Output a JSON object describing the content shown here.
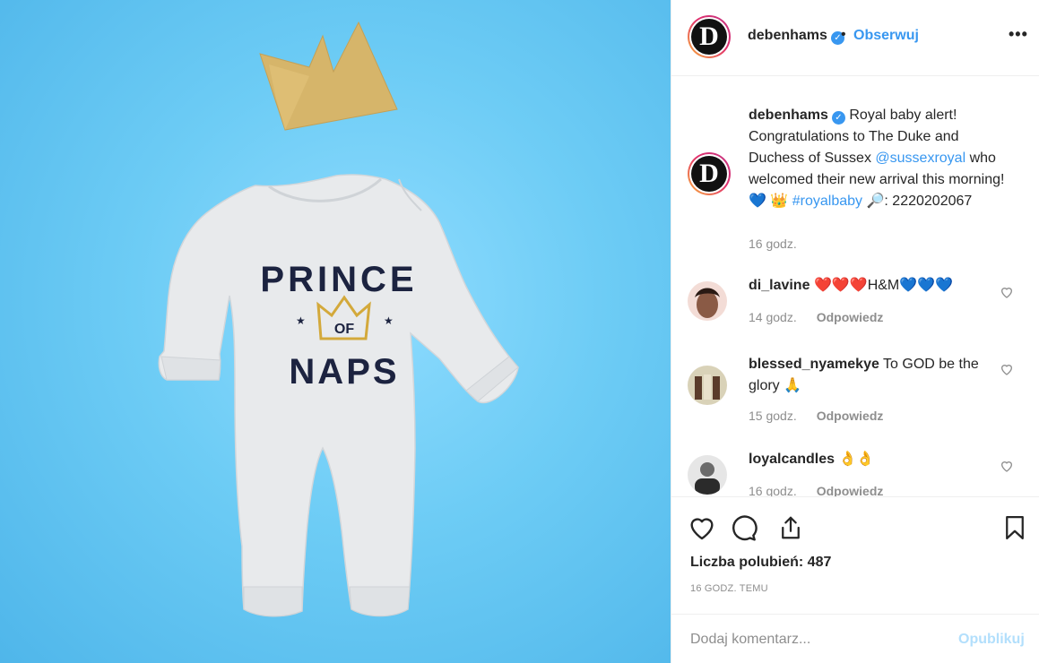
{
  "post": {
    "username": "debenhams",
    "follow_label": "Obserwuj",
    "more_label": "•••",
    "separator": "•"
  },
  "photo": {
    "shirt_line1": "PRINCE",
    "shirt_line2": "OF",
    "shirt_line3": "NAPS"
  },
  "caption": {
    "username": "debenhams",
    "text_1": "Royal baby alert! Congratulations to The Duke and Duchess of Sussex ",
    "mention": "@sussexroyal",
    "text_2": " who welcomed their new arrival this morning! ",
    "emoji_1": "💙",
    "emoji_2": "👑",
    "hashtag": "#royalbaby",
    "emoji_3": "🔎",
    "text_3": ": 2220202067",
    "time": "16 godz."
  },
  "comments": [
    {
      "username": "di_lavine",
      "text": "❤️❤️❤️H&M💙💙💙",
      "time": "14 godz.",
      "reply_label": "Odpowiedz"
    },
    {
      "username": "blessed_nyamekye",
      "text": "To GOD be the glory 🙏",
      "time": "15 godz.",
      "reply_label": "Odpowiedz"
    },
    {
      "username": "loyalcandles",
      "text": "👌👌",
      "time": "16 godz.",
      "reply_label": "Odpowiedz"
    }
  ],
  "actions": {
    "likes_label": "Liczba polubień: 487",
    "time_ago": "16 GODZ. TEMU"
  },
  "add_comment": {
    "placeholder": "Dodaj komentarz...",
    "post_label": "Opublikuj"
  },
  "colors": {
    "link": "#3897f0",
    "muted": "#8e8e8e",
    "background_photo": "#6dccf5"
  },
  "icons": [
    "verified-icon",
    "more-icon",
    "heart-icon",
    "comment-icon",
    "share-icon",
    "bookmark-icon"
  ]
}
